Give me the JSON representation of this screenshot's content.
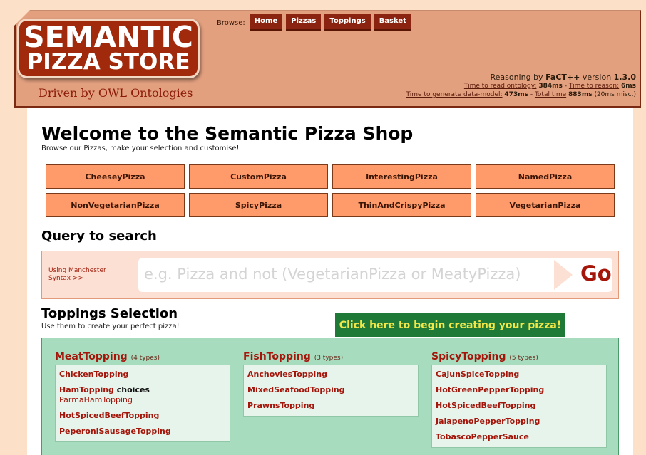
{
  "logo": {
    "line1": "SEMANTIC",
    "line2": "PIZZA STORE",
    "tagline": "Driven by OWL Ontologies"
  },
  "nav": {
    "label": "Browse:",
    "items": [
      "Home",
      "Pizzas",
      "Toppings",
      "Basket"
    ]
  },
  "reasoning": {
    "prefix": "Reasoning by ",
    "engine": "FaCT++",
    "version_label": " version ",
    "version": "1.3.0",
    "read_label": "Time to read ontology:",
    "read_value": "384ms",
    "reason_label": "Time to reason:",
    "reason_value": "6ms",
    "model_label": "Time to generate data-model:",
    "model_value": "473ms",
    "total_label": "Total time",
    "total_value": "883ms",
    "misc": "(20ms misc.)"
  },
  "main": {
    "title": "Welcome to the Semantic Pizza Shop",
    "subtitle": "Browse our Pizzas, make your selection and customise!",
    "categories": [
      "CheeseyPizza",
      "CustomPizza",
      "InterestingPizza",
      "NamedPizza",
      "NonVegetarianPizza",
      "SpicyPizza",
      "ThinAndCrispyPizza",
      "VegetarianPizza"
    ]
  },
  "query": {
    "title": "Query to search",
    "hint_line1": "Using Manchester",
    "hint_line2": "Syntax >>",
    "placeholder": "e.g. Pizza and not (VegetarianPizza or MeatyPizza)",
    "go": "Go"
  },
  "toppings": {
    "title": "Toppings Selection",
    "subtitle": "Use them to create your perfect pizza!",
    "cta": "Click here to begin creating your pizza!",
    "meat": {
      "name": "MeatTopping",
      "count": "(4 types)",
      "items": [
        "ChickenTopping",
        "HamTopping",
        "HotSpicedBeefTopping",
        "PeperoniSausageTopping"
      ],
      "choices_label": "choices",
      "sub_item": "ParmaHamTopping"
    },
    "fish": {
      "name": "FishTopping",
      "count": "(3 types)",
      "items": [
        "AnchoviesTopping",
        "MixedSeafoodTopping",
        "PrawnsTopping"
      ]
    },
    "spicy": {
      "name": "SpicyTopping",
      "count": "(5 types)",
      "items": [
        "CajunSpiceTopping",
        "HotGreenPepperTopping",
        "HotSpicedBeefTopping",
        "JalapenoPepperTopping",
        "TobascoPepperSauce"
      ]
    }
  },
  "colors": {
    "brand": "#a12a0c",
    "accent": "#ff9a6a",
    "cta_bg": "#1f7a38",
    "cta_text": "#f2e74a",
    "panel": "#a7dcbf"
  }
}
